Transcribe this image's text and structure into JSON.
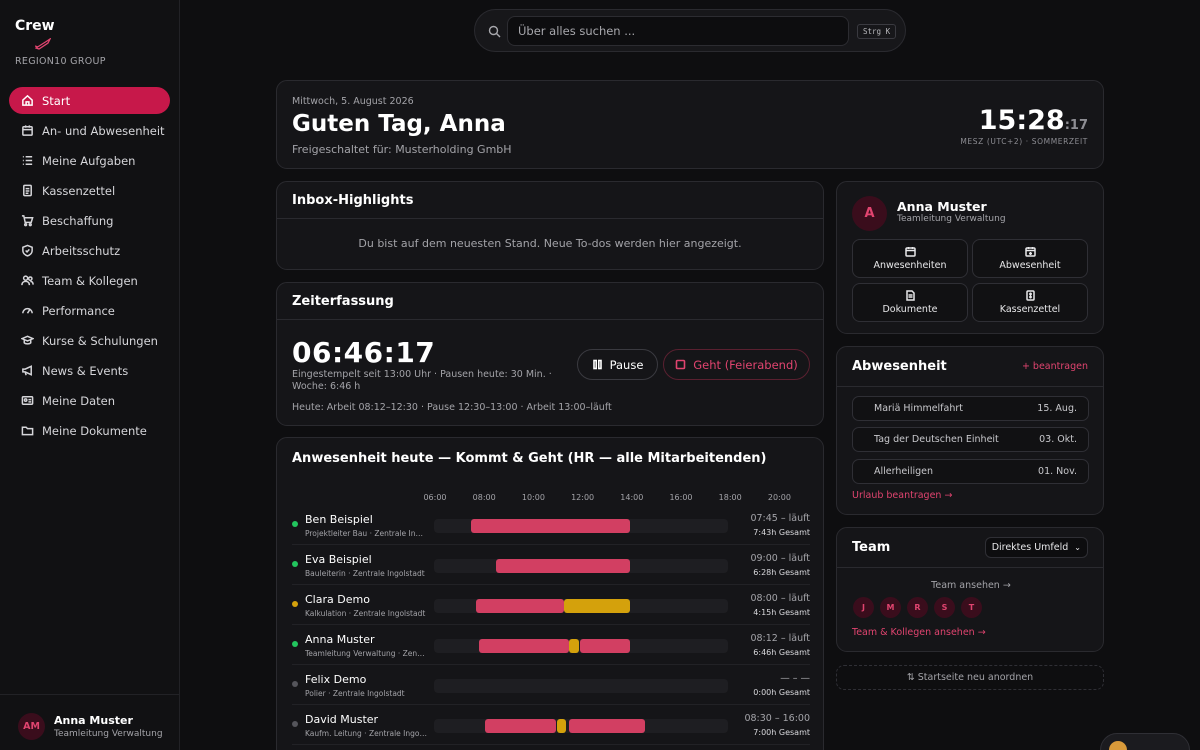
{
  "sidebar": {
    "brand": "Crew",
    "group": "REGION10 GROUP",
    "items": [
      {
        "label": "Start",
        "icon": "home-icon"
      },
      {
        "label": "An- und Abwesenheit",
        "icon": "calendar-icon"
      },
      {
        "label": "Meine Aufgaben",
        "icon": "list-icon"
      },
      {
        "label": "Kassenzettel",
        "icon": "receipt-icon"
      },
      {
        "label": "Beschaffung",
        "icon": "cart-icon"
      },
      {
        "label": "Arbeitsschutz",
        "icon": "shield-icon"
      },
      {
        "label": "Team & Kollegen",
        "icon": "users-icon"
      },
      {
        "label": "Performance",
        "icon": "gauge-icon"
      },
      {
        "label": "Kurse & Schulungen",
        "icon": "graduation-icon"
      },
      {
        "label": "News & Events",
        "icon": "megaphone-icon"
      },
      {
        "label": "Meine Daten",
        "icon": "id-card-icon"
      },
      {
        "label": "Meine Dokumente",
        "icon": "folder-icon"
      }
    ],
    "user": {
      "initials": "AM",
      "name": "Anna Muster",
      "role": "Teamleitung Verwaltung"
    }
  },
  "search": {
    "placeholder": "Über alles suchen ...",
    "shortcut": "Strg K"
  },
  "greeting": {
    "date": "Mittwoch, 5. August 2026",
    "title": "Guten Tag, Anna",
    "subtitle": "Freigeschaltet für: Musterholding GmbH",
    "clock_main": "15:28",
    "clock_sec": ":17",
    "timezone": "MESZ (UTC+2) · SOMMERZEIT"
  },
  "inbox": {
    "title": "Inbox-Highlights",
    "empty": "Du bist auf dem neuesten Stand. Neue To-dos werden hier angezeigt."
  },
  "zeit": {
    "title": "Zeiterfassung",
    "timer": "06:46:17",
    "since": "Eingestempelt seit 13:00 Uhr · Pausen heute: 30 Min. · Woche: 6:46 h",
    "log": "Heute: Arbeit 08:12–12:30 · Pause 12:30–13:00 · Arbeit 13:00–läuft",
    "pause_label": "Pause",
    "geht_label": "Geht (Feierabend)"
  },
  "attendance": {
    "title": "Anwesenheit heute — Kommt & Geht (HR — alle Mitarbeitenden)",
    "hours": [
      "06:00",
      "08:00",
      "10:00",
      "12:00",
      "14:00",
      "16:00",
      "18:00",
      "20:00"
    ],
    "rows": [
      {
        "name": "Ben Beispiel",
        "role": "Projektleiter Bau · Zentrale Ingolstadt",
        "status": "present",
        "span": "07:45 – läuft",
        "total": "7:43h Gesamt",
        "segments": [
          {
            "from": 7.5,
            "to": 14.0,
            "kind": "work"
          }
        ]
      },
      {
        "name": "Eva Beispiel",
        "role": "Bauleiterin · Zentrale Ingolstadt",
        "status": "present",
        "span": "09:00 – läuft",
        "total": "6:28h Gesamt",
        "segments": [
          {
            "from": 8.55,
            "to": 14.0,
            "kind": "work"
          }
        ]
      },
      {
        "name": "Clara Demo",
        "role": "Kalkulation · Zentrale Ingolstadt",
        "status": "pause",
        "span": "08:00 – läuft",
        "total": "4:15h Gesamt",
        "segments": [
          {
            "from": 7.7,
            "to": 11.3,
            "kind": "work"
          },
          {
            "from": 11.3,
            "to": 14.0,
            "kind": "pause"
          }
        ]
      },
      {
        "name": "Anna Muster",
        "role": "Teamleitung Verwaltung · Zentrale Ingolstadt",
        "status": "present",
        "span": "08:12 – läuft",
        "total": "6:46h Gesamt",
        "segments": [
          {
            "from": 7.85,
            "to": 11.5,
            "kind": "work"
          },
          {
            "from": 11.5,
            "to": 11.9,
            "kind": "pause"
          },
          {
            "from": 11.95,
            "to": 14.0,
            "kind": "work"
          }
        ]
      },
      {
        "name": "Felix Demo",
        "role": "Polier · Zentrale Ingolstadt",
        "status": "absent",
        "span": "— – —",
        "total": "0:00h Gesamt",
        "segments": []
      },
      {
        "name": "David Muster",
        "role": "Kaufm. Leitung · Zentrale Ingolstadt",
        "status": "absent",
        "span": "08:30 – 16:00",
        "total": "7:00h Gesamt",
        "segments": [
          {
            "from": 8.1,
            "to": 11.0,
            "kind": "work"
          },
          {
            "from": 11.0,
            "to": 11.4,
            "kind": "pause"
          },
          {
            "from": 11.5,
            "to": 14.6,
            "kind": "work"
          }
        ]
      }
    ]
  },
  "profile": {
    "initial": "A",
    "name": "Anna Muster",
    "role": "Teamleitung Verwaltung",
    "buttons": [
      {
        "label": "Anwesenheiten",
        "icon": "calendar-icon"
      },
      {
        "label": "Abwesenheit",
        "icon": "calendar-plus-icon"
      },
      {
        "label": "Dokumente",
        "icon": "document-icon"
      },
      {
        "label": "Kassenzettel",
        "icon": "receipt-icon"
      }
    ]
  },
  "absence": {
    "title": "Abwesenheit",
    "request_label": "+ beantragen",
    "items": [
      {
        "name": "Mariä Himmelfahrt",
        "date": "15. Aug."
      },
      {
        "name": "Tag der Deutschen Einheit",
        "date": "03. Okt."
      },
      {
        "name": "Allerheiligen",
        "date": "01. Nov."
      }
    ],
    "footer_link": "Urlaub beantragen →"
  },
  "team": {
    "title": "Team",
    "filter": "Direktes Umfeld",
    "view_label": "Team ansehen →",
    "members": [
      "J",
      "M",
      "R",
      "S",
      "T"
    ],
    "link": "Team & Kollegen ansehen →"
  },
  "reorder_label": "⇅ Startseite neu anordnen",
  "colors": {
    "accent": "#c7184a",
    "work": "#d23f62",
    "pause": "#d4a10c",
    "present": "#22c55e",
    "absent": "#55555b"
  }
}
